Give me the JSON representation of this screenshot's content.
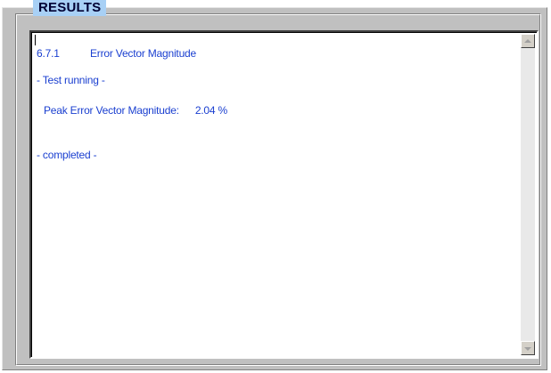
{
  "group": {
    "title": "RESULTS"
  },
  "results": {
    "test_id": "6.7.1",
    "test_name": "Error Vector Magnitude",
    "status_running": "- Test running -",
    "metric_label": "Peak Error Vector Magnitude:",
    "metric_value": "2.04 %",
    "status_done": "- completed -"
  },
  "icons": {
    "scroll_up": "scroll-up-arrow-icon",
    "scroll_down": "scroll-down-arrow-icon"
  },
  "colors": {
    "text": "#1a3fd0",
    "title_bg": "#a8d0f5",
    "panel_bg": "#c0c0c0"
  }
}
